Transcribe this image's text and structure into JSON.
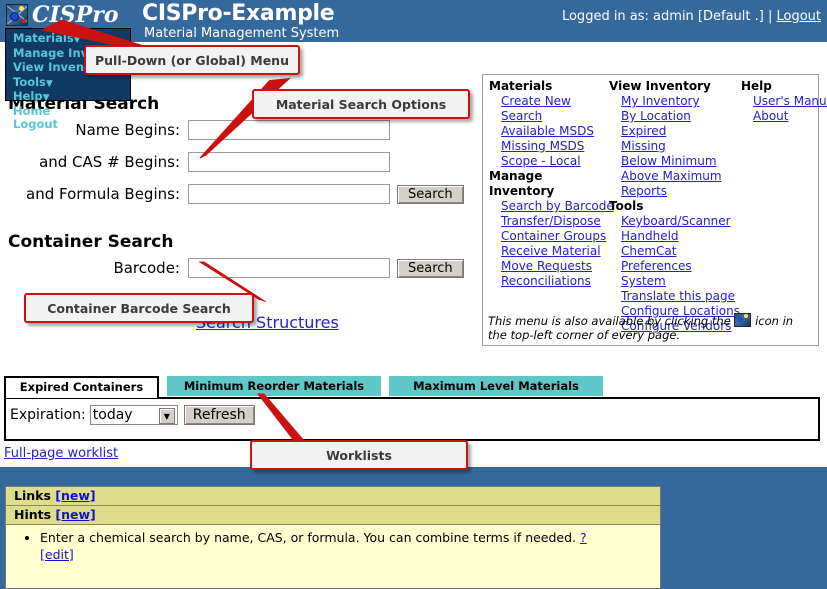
{
  "header": {
    "logo_text": "CISPro",
    "logo_icon": "cispro-map-icon",
    "app_title": "CISPro-Example",
    "app_subtitle": "Material Management System",
    "login_text": "Logged in as: admin [Default .] |",
    "logout_label": "Logout",
    "bg_color": "#36699b"
  },
  "pulldown_menu": {
    "items": [
      {
        "label": "Materials",
        "has_caret": true
      },
      {
        "label": "Manage Inventory",
        "has_caret": true
      },
      {
        "label": "View Inventory",
        "has_caret": true
      },
      {
        "label": "Tools",
        "has_caret": true
      },
      {
        "label": "Help",
        "has_caret": true
      },
      {
        "label": "Home",
        "has_caret": false
      },
      {
        "label": "Logout",
        "has_caret": false
      }
    ],
    "text_color": "#57c7d8",
    "bg_color": "#0f3a63"
  },
  "material_search": {
    "heading": "Material Search",
    "rows": [
      {
        "label": "Name Begins:",
        "value": "",
        "placeholder": ""
      },
      {
        "label": "and CAS # Begins:",
        "value": "",
        "placeholder": ""
      },
      {
        "label": "and Formula Begins:",
        "value": "",
        "placeholder": ""
      }
    ],
    "search_button": "Search"
  },
  "container_search": {
    "heading": "Container Search",
    "label": "Barcode:",
    "value": "",
    "placeholder": "",
    "search_button": "Search"
  },
  "search_structures_link": "Search Structures",
  "menu_panel": {
    "columns": [
      {
        "groups": [
          {
            "head": "Materials",
            "links": [
              "Create New",
              "Search",
              "Available MSDS",
              "Missing MSDS",
              "Scope - Local"
            ]
          },
          {
            "head": "Manage Inventory",
            "links": [
              "Search by Barcode",
              "Transfer/Dispose",
              "Container Groups",
              "Receive Material",
              "Move Requests",
              "Reconciliations"
            ]
          }
        ]
      },
      {
        "groups": [
          {
            "head": "View Inventory",
            "links": [
              "My Inventory",
              "By Location",
              "Expired",
              "Missing",
              "Below Minimum",
              "Above Maximum",
              "Reports"
            ]
          },
          {
            "head": "Tools",
            "links": [
              "Keyboard/Scanner",
              "Handheld",
              "ChemCat",
              "Preferences",
              "System",
              "Translate this page",
              "Configure Locations",
              "Configure Vendors"
            ]
          }
        ]
      },
      {
        "groups": [
          {
            "head": "Help",
            "links": [
              "User's Manual",
              "About"
            ]
          }
        ]
      }
    ],
    "note_before": "This menu is also available by clicking the",
    "note_after": "icon in the top-left corner of every page."
  },
  "worklists": {
    "tabs": [
      {
        "label": "Expired Containers",
        "active": true
      },
      {
        "label": "Minimum Reorder Materials",
        "active": false
      },
      {
        "label": "Maximum Level Materials",
        "active": false
      }
    ],
    "tab_inactive_color": "#5ec8c8",
    "expiration_label": "Expiration:",
    "expiration_value": "today",
    "expiration_options": [
      "today"
    ],
    "refresh_button": "Refresh",
    "fullpage_link": "Full-page worklist"
  },
  "bottom_panel": {
    "links_label": "Links",
    "links_new": "[new]",
    "hints_label": "Hints",
    "hints_new": "[new]",
    "hint_text": "Enter a chemical search by name, CAS, or formula. You can combine terms if needed.",
    "hint_help": "?",
    "hint_edit": "[edit]"
  },
  "callouts": {
    "pulldown": "Pull-Down (or Global) Menu",
    "material_search": "Material Search Options",
    "container_barcode": "Container Barcode Search",
    "worklists": "Worklists",
    "border_color": "#cc1111"
  }
}
